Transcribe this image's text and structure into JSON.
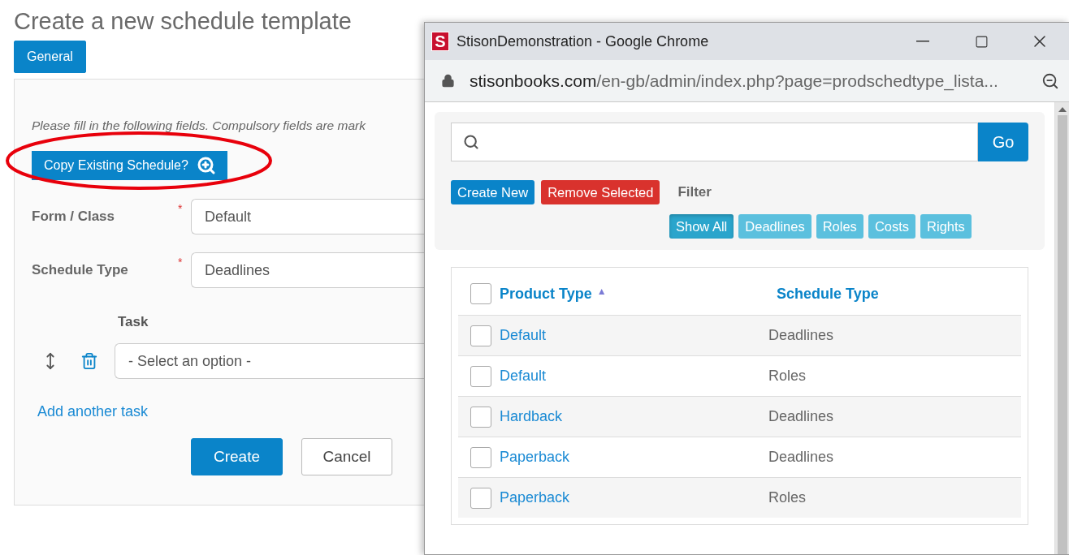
{
  "form": {
    "title": "Create a new schedule template",
    "tabs": [
      {
        "label": "General",
        "selected": true
      }
    ],
    "instructions": "Please fill in the following fields. Compulsory fields are mark",
    "copy_button": "Copy Existing Schedule?",
    "fields": [
      {
        "label": "Form / Class",
        "required_mark": "*",
        "value": "Default"
      },
      {
        "label": "Schedule Type",
        "required_mark": "*",
        "value": "Deadlines"
      }
    ],
    "task": {
      "label": "Task",
      "placeholder": "- Select an option -"
    },
    "add_link": "Add another task",
    "buttons": [
      {
        "label": "Create",
        "kind": "primary"
      },
      {
        "label": "Cancel",
        "kind": "secondary"
      }
    ]
  },
  "browser": {
    "logo": "S",
    "title": "StisonDemonstration - Google Chrome",
    "url_domain": "stisonbooks.com",
    "url_path": "/en-gb/admin/index.php?page=prodschedtype_lista...",
    "search_button": "Go",
    "actions": [
      {
        "label": "Create New",
        "kind": "primary"
      },
      {
        "label": "Remove Selected",
        "kind": "danger"
      }
    ],
    "filter_label": "Filter",
    "filters": [
      {
        "label": "Show All",
        "selected": true
      },
      {
        "label": "Deadlines",
        "selected": false
      },
      {
        "label": "Roles",
        "selected": false
      },
      {
        "label": "Costs",
        "selected": false
      },
      {
        "label": "Rights",
        "selected": false
      }
    ],
    "table": {
      "select_all_checked": false,
      "columns": [
        {
          "label": "Product Type",
          "sort_icon": "▲"
        },
        {
          "label": "Schedule Type"
        }
      ],
      "rows": [
        {
          "checked": false,
          "cells": [
            "Default",
            "Deadlines"
          ]
        },
        {
          "checked": false,
          "cells": [
            "Default",
            "Roles"
          ]
        },
        {
          "checked": false,
          "cells": [
            "Hardback",
            "Deadlines"
          ]
        },
        {
          "checked": false,
          "cells": [
            "Paperback",
            "Deadlines"
          ]
        },
        {
          "checked": false,
          "cells": [
            "Paperback",
            "Roles"
          ]
        }
      ]
    }
  }
}
